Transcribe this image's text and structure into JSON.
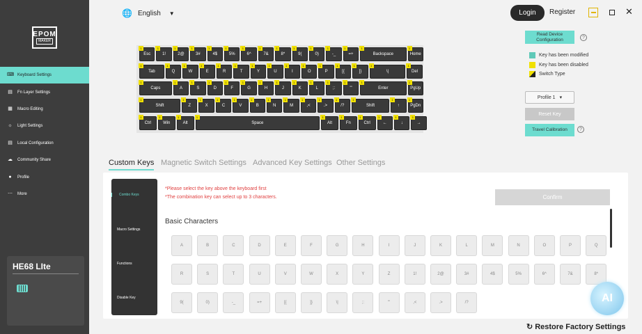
{
  "brand": {
    "logo_line1": "EPOM",
    "logo_line2": "MAKER"
  },
  "sidebar": {
    "items": [
      {
        "label": "Keyboard Settings",
        "icon": "keyboard-icon"
      },
      {
        "label": "Fn Layer Settings",
        "icon": "layers-icon"
      },
      {
        "label": "Macro Editing",
        "icon": "macro-icon"
      },
      {
        "label": "Light Settings",
        "icon": "light-icon"
      },
      {
        "label": "Local Configuration",
        "icon": "folder-icon"
      },
      {
        "label": "Community Share",
        "icon": "cloud-icon"
      },
      {
        "label": "Profile",
        "icon": "user-icon"
      },
      {
        "label": "More",
        "icon": "more-icon"
      }
    ],
    "device_name": "HE68 LIte"
  },
  "topbar": {
    "language": "English",
    "login": "Login",
    "register": "Register"
  },
  "keyboard": {
    "rows": [
      [
        "Esc",
        "1!",
        "2@",
        "3#",
        "4$",
        "5%",
        "6^",
        "7&",
        "8*",
        "9(",
        "0)",
        "-_",
        "=+",
        "Backspace",
        "Home"
      ],
      [
        "Tab",
        "Q",
        "W",
        "E",
        "R",
        "T",
        "Y",
        "U",
        "I",
        "O",
        "P",
        "[{",
        "]}",
        "\\|",
        "Del"
      ],
      [
        "Caps",
        "A",
        "S",
        "D",
        "F",
        "G",
        "H",
        "J",
        "K",
        "L",
        ";:",
        "'\"",
        "Enter",
        "PgUp"
      ],
      [
        "Shift",
        "Z",
        "X",
        "C",
        "V",
        "B",
        "N",
        "M",
        ",<",
        ".>",
        "/?",
        "Shift",
        "↑",
        "PgDn"
      ],
      [
        "Ctrl",
        "Win",
        "Alt",
        "Space",
        "Alt",
        "Fn",
        "Ctrl",
        "←",
        "↓",
        "→"
      ]
    ]
  },
  "right_panel": {
    "read_device": "Read Device Configuration",
    "legend_modified": "Key has been modified",
    "legend_disabled": "Key has been disabled",
    "legend_switch": "Switch Type",
    "profile": "Profile 1",
    "reset_key": "Reset Key",
    "travel": "Travel Calibration",
    "colors": {
      "modified": "#5fc9b8",
      "disabled": "#f0e000",
      "accent": "#6ddccf"
    }
  },
  "tabs": [
    "Custom Keys",
    "Magnetic Switch Settings",
    "Advanced Key Settings",
    "Other Settings"
  ],
  "subnav": [
    "Combo Keys",
    "Macro Settings",
    "Functions",
    "Disable Key"
  ],
  "content": {
    "hint1": "*Please select the key above the keyboard first",
    "hint2": "*The combination key can select up to 3 characters.",
    "confirm": "Confirm",
    "basic_title": "Basic Characters",
    "chars_row1": [
      "A",
      "B",
      "C",
      "D",
      "E",
      "F",
      "G",
      "H",
      "I",
      "J",
      "K",
      "L",
      "M",
      "N",
      "O",
      "P",
      "Q"
    ],
    "chars_row2": [
      "R",
      "S",
      "T",
      "U",
      "V",
      "W",
      "X",
      "Y",
      "Z",
      "1!",
      "2@",
      "3#",
      "4$",
      "5%",
      "6^",
      "7&",
      "8*"
    ],
    "chars_row3": [
      "9(",
      "0)",
      "-_",
      "=+",
      "[{",
      "]}",
      "\\|",
      ";:",
      "'\"",
      ",<",
      ".>",
      "/?"
    ]
  },
  "footer": {
    "restore": "Restore Factory Settings"
  },
  "badge": "AI"
}
